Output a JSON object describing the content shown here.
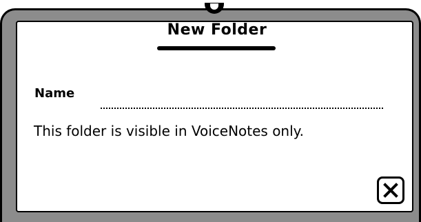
{
  "dialog": {
    "title": "New Folder",
    "name_label": "Name",
    "name_value": "",
    "info_text": "This folder is visible in VoiceNotes only."
  },
  "icons": {
    "close": "close-icon",
    "drag_knob": "drag-knob-icon"
  },
  "colors": {
    "frame_gray": "#8c8c8c",
    "panel_white": "#ffffff",
    "ink_black": "#000000"
  }
}
